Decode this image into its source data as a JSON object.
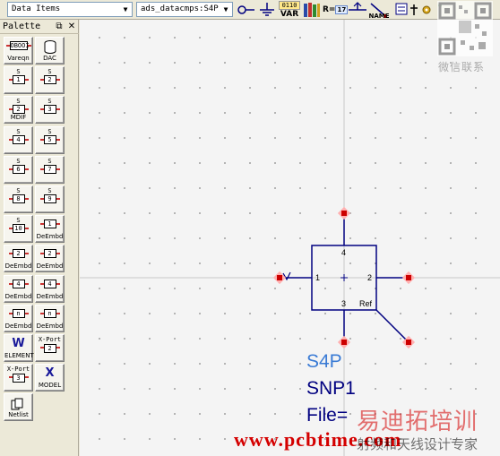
{
  "toolbar": {
    "data_items": "Data Items",
    "component": "ads_datacmps:S4P",
    "var_label": "VAR",
    "var_top": "0110",
    "r_label": "R=",
    "r_value": "17",
    "name_label": "NAME"
  },
  "palette": {
    "title": "Palette",
    "items": [
      {
        "name": "vareqn",
        "top": "",
        "box": "OBOOI",
        "cap": "Vareqn"
      },
      {
        "name": "dac",
        "top": "",
        "box": "",
        "cap": "DAC"
      },
      {
        "name": "s1p",
        "top": "S",
        "box": "1",
        "cap": ""
      },
      {
        "name": "s2p",
        "top": "S",
        "box": "2",
        "cap": ""
      },
      {
        "name": "s2p-mdif",
        "top": "S",
        "box": "2",
        "cap": "MDIF"
      },
      {
        "name": "s3p",
        "top": "S",
        "box": "3",
        "cap": ""
      },
      {
        "name": "s4p",
        "top": "S",
        "box": "4",
        "cap": ""
      },
      {
        "name": "s5p",
        "top": "S",
        "box": "5",
        "cap": ""
      },
      {
        "name": "s6p",
        "top": "S",
        "box": "6",
        "cap": ""
      },
      {
        "name": "s7p",
        "top": "S",
        "box": "7",
        "cap": ""
      },
      {
        "name": "s8p",
        "top": "S",
        "box": "8",
        "cap": ""
      },
      {
        "name": "s9p",
        "top": "S",
        "box": "9",
        "cap": ""
      },
      {
        "name": "s10p",
        "top": "S",
        "box": "10",
        "cap": ""
      },
      {
        "name": "deembed1",
        "top": "",
        "box": "1",
        "cap": "DeEmbd"
      },
      {
        "name": "deembed2",
        "top": "",
        "box": "2",
        "cap": "DeEmbd"
      },
      {
        "name": "deembed2b",
        "top": "",
        "box": "2",
        "cap": "DeEmbd"
      },
      {
        "name": "deembed4",
        "top": "",
        "box": "4",
        "cap": "DeEmbd"
      },
      {
        "name": "deembed4b",
        "top": "",
        "box": "4",
        "cap": "DeEmbd"
      },
      {
        "name": "deembedn",
        "top": "",
        "box": "n",
        "cap": "DeEmbd"
      },
      {
        "name": "deembedn2",
        "top": "",
        "box": "n",
        "cap": "DeEmbd"
      },
      {
        "name": "element",
        "top": "",
        "box": "W",
        "cap": "ELEMENT"
      },
      {
        "name": "xport2",
        "top": "X-Port",
        "box": "2",
        "cap": ""
      },
      {
        "name": "xport3",
        "top": "X-Port",
        "box": "3",
        "cap": ""
      },
      {
        "name": "model",
        "top": "",
        "box": "X",
        "cap": "MODEL"
      },
      {
        "name": "netlist",
        "top": "",
        "box": "",
        "cap": "Netlist"
      }
    ]
  },
  "schematic": {
    "port1": "1",
    "port2": "2",
    "port3": "3",
    "port4": "4",
    "ref": "Ref",
    "comp_type": "S4P",
    "comp_name": "SNP1",
    "file_label": "File="
  },
  "watermark": {
    "cn1": "易迪拓培训",
    "url": "www.pcbtime.com",
    "cn2": "射频和天线设计专家",
    "wechat": "微信联系"
  },
  "colors": {
    "pin": "#cc0000",
    "wire": "#000080",
    "comp_type": "#3a7bd5",
    "comp_name": "#000080",
    "wm_red": "#d40000"
  }
}
